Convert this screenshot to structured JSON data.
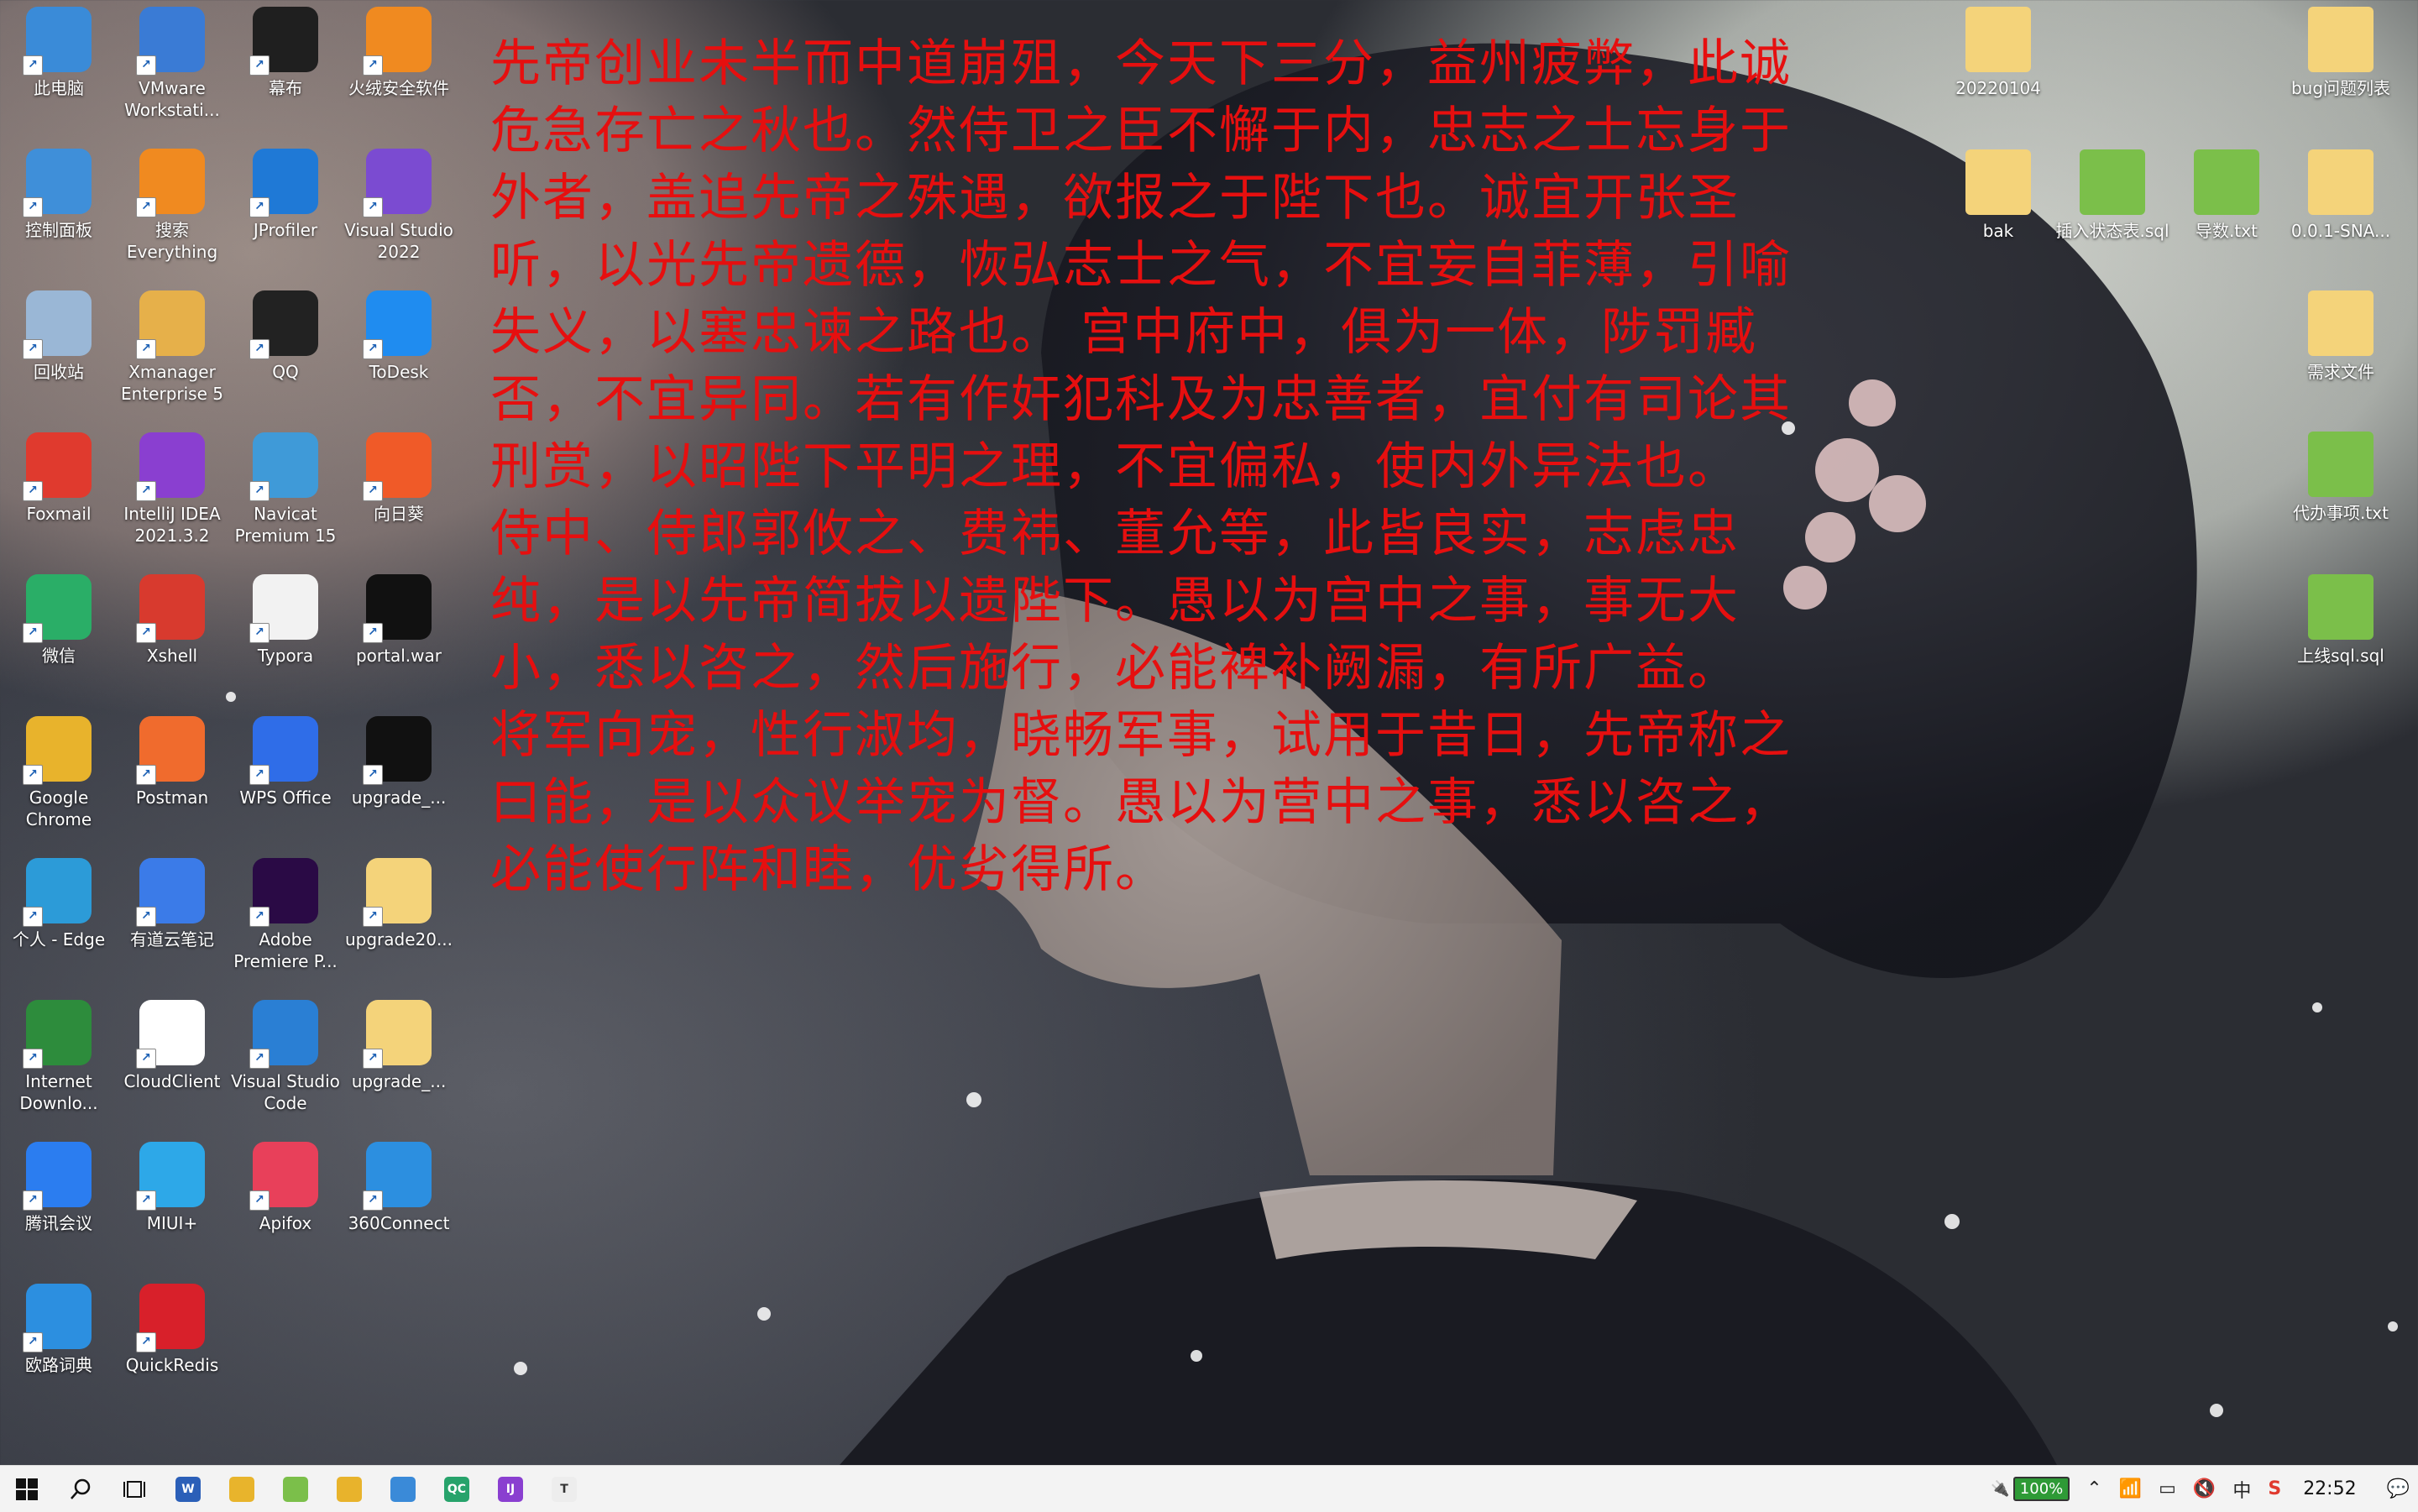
{
  "desktop_icons_left": [
    {
      "label": "此电脑",
      "icon": "computer-icon",
      "color": "#3a8bd8"
    },
    {
      "label": "VMware Workstati...",
      "icon": "vmware-icon",
      "color": "#3a7bd5"
    },
    {
      "label": "幕布",
      "icon": "mubu-icon",
      "color": "#1f1f1f"
    },
    {
      "label": "火绒安全软件",
      "icon": "huorong-icon",
      "color": "#f08a20"
    },
    {
      "label": "控制面板",
      "icon": "control-panel-icon",
      "color": "#3f8fd9"
    },
    {
      "label": "搜索 Everything",
      "icon": "everything-icon",
      "color": "#f08a20"
    },
    {
      "label": "JProfiler",
      "icon": "jprofiler-icon",
      "color": "#1f79d6"
    },
    {
      "label": "Visual Studio 2022",
      "icon": "visual-studio-icon",
      "color": "#7b4bd1"
    },
    {
      "label": "回收站",
      "icon": "recycle-bin-icon",
      "color": "#9ab7d6"
    },
    {
      "label": "Xmanager Enterprise 5",
      "icon": "xmanager-icon",
      "color": "#e6b04a"
    },
    {
      "label": "QQ",
      "icon": "qq-icon",
      "color": "#222222"
    },
    {
      "label": "ToDesk",
      "icon": "todesk-icon",
      "color": "#1f8cf0"
    },
    {
      "label": "Foxmail",
      "icon": "foxmail-icon",
      "color": "#e03a2e"
    },
    {
      "label": "IntelliJ IDEA 2021.3.2",
      "icon": "intellij-icon",
      "color": "#8a3fd0"
    },
    {
      "label": "Navicat Premium 15",
      "icon": "navicat-icon",
      "color": "#3f9ad8"
    },
    {
      "label": "向日葵",
      "icon": "sunlogin-icon",
      "color": "#f05a28"
    },
    {
      "label": "微信",
      "icon": "wechat-icon",
      "color": "#2aae67"
    },
    {
      "label": "Xshell",
      "icon": "xshell-icon",
      "color": "#d83a2e"
    },
    {
      "label": "Typora",
      "icon": "typora-icon",
      "color": "#f2f2f2"
    },
    {
      "label": "portal.war",
      "icon": "7zip-icon",
      "color": "#111111"
    },
    {
      "label": "Google Chrome",
      "icon": "chrome-icon",
      "color": "#e8b32c"
    },
    {
      "label": "Postman",
      "icon": "postman-icon",
      "color": "#f06b2d"
    },
    {
      "label": "WPS Office",
      "icon": "wps-icon",
      "color": "#2f6de8"
    },
    {
      "label": "upgrade_...",
      "icon": "7zip-icon",
      "color": "#111111"
    },
    {
      "label": "个人 - Edge",
      "icon": "edge-icon",
      "color": "#2c9bd8"
    },
    {
      "label": "有道云笔记",
      "icon": "youdao-note-icon",
      "color": "#3b7be8"
    },
    {
      "label": "Adobe Premiere P...",
      "icon": "premiere-icon",
      "color": "#2a0a45"
    },
    {
      "label": "upgrade20...",
      "icon": "chrome-file-icon",
      "color": "#f4d37a"
    },
    {
      "label": "Internet Downlo...",
      "icon": "idm-icon",
      "color": "#2d8c3c"
    },
    {
      "label": "CloudClient",
      "icon": "cloudclient-icon",
      "color": "#ffffff"
    },
    {
      "label": "Visual Studio Code",
      "icon": "vscode-icon",
      "color": "#2a7fd4"
    },
    {
      "label": "upgrade_...",
      "icon": "folder-file-icon",
      "color": "#f4d37a"
    },
    {
      "label": "腾讯会议",
      "icon": "tencent-meeting-icon",
      "color": "#2b7df0"
    },
    {
      "label": "MIUI+",
      "icon": "miui-icon",
      "color": "#2da8e8"
    },
    {
      "label": "Apifox",
      "icon": "apifox-icon",
      "color": "#e8405a"
    },
    {
      "label": "360Connect",
      "icon": "360connect-icon",
      "color": "#2c8fe0"
    },
    {
      "label": "欧路词典",
      "icon": "eudic-icon",
      "color": "#2c8fe0"
    },
    {
      "label": "QuickRedis",
      "icon": "quickredis-icon",
      "color": "#d8202a"
    }
  ],
  "desktop_icons_right": [
    {
      "label": "20220104",
      "icon": "folder-icon",
      "color": "#f4d37a"
    },
    {
      "label": "bug问题列表",
      "icon": "folder-icon",
      "color": "#f4d37a"
    },
    {
      "label": "bak",
      "icon": "folder-icon",
      "color": "#f4d37a"
    },
    {
      "label": "插入状态表.sql",
      "icon": "notepad-icon",
      "color": "#7bbf4a"
    },
    {
      "label": "导数.txt",
      "icon": "notepad-icon",
      "color": "#7bbf4a"
    },
    {
      "label": "0.0.1-SNA...",
      "icon": "folder-icon",
      "color": "#f4d37a"
    },
    {
      "label": "需求文件",
      "icon": "folder-icon",
      "color": "#f4d37a"
    },
    {
      "label": "代办事项.txt",
      "icon": "notepad-icon",
      "color": "#7bbf4a"
    },
    {
      "label": "上线sql.sql",
      "icon": "notepad-icon",
      "color": "#7bbf4a"
    }
  ],
  "poem_text": "先帝创业未半而中道崩殂，今天下三分，益州疲弊，此诚危急存亡之秋也。然侍卫之臣不懈于内，忠志之士忘身于外者，盖追先帝之殊遇，欲报之于陛下也。诚宜开张圣听，以光先帝遗德，恢弘志士之气，不宜妄自菲薄，引喻失义，以塞忠谏之路也。 宫中府中，俱为一体，陟罚臧否，不宜异同。若有作奸犯科及为忠善者，宜付有司论其刑赏，以昭陛下平明之理，不宜偏私，使内外异法也。 侍中、侍郎郭攸之、费祎、董允等，此皆良实，志虑忠纯，是以先帝简拔以遗陛下。愚以为宫中之事，事无大小，悉以咨之，然后施行，必能裨补阙漏，有所广益。 将军向宠，性行淑均，晓畅军事，试用于昔日，先帝称之曰能，是以众议举宠为督。愚以为营中之事，悉以咨之，必能使行阵和睦，优劣得所。",
  "taskbar": {
    "start_icon": "windows-start-icon",
    "search_icon": "search-icon",
    "taskview_icon": "task-view-icon",
    "apps": [
      {
        "name": "word",
        "color": "#2b5fb8",
        "glyph": "W"
      },
      {
        "name": "explorer",
        "color": "#e8b42c",
        "glyph": ""
      },
      {
        "name": "notepad-plus",
        "color": "#7bbf4a",
        "glyph": ""
      },
      {
        "name": "chrome",
        "color": "#e8b32c",
        "glyph": ""
      },
      {
        "name": "sourcetree",
        "color": "#3a8ad8",
        "glyph": ""
      },
      {
        "name": "qc",
        "color": "#27a36b",
        "glyph": "QC"
      },
      {
        "name": "intellij",
        "color": "#8a3fd0",
        "glyph": "IJ"
      },
      {
        "name": "typora",
        "color": "#ededed",
        "glyph": "T"
      }
    ],
    "battery": "100%",
    "time": "22:52"
  }
}
